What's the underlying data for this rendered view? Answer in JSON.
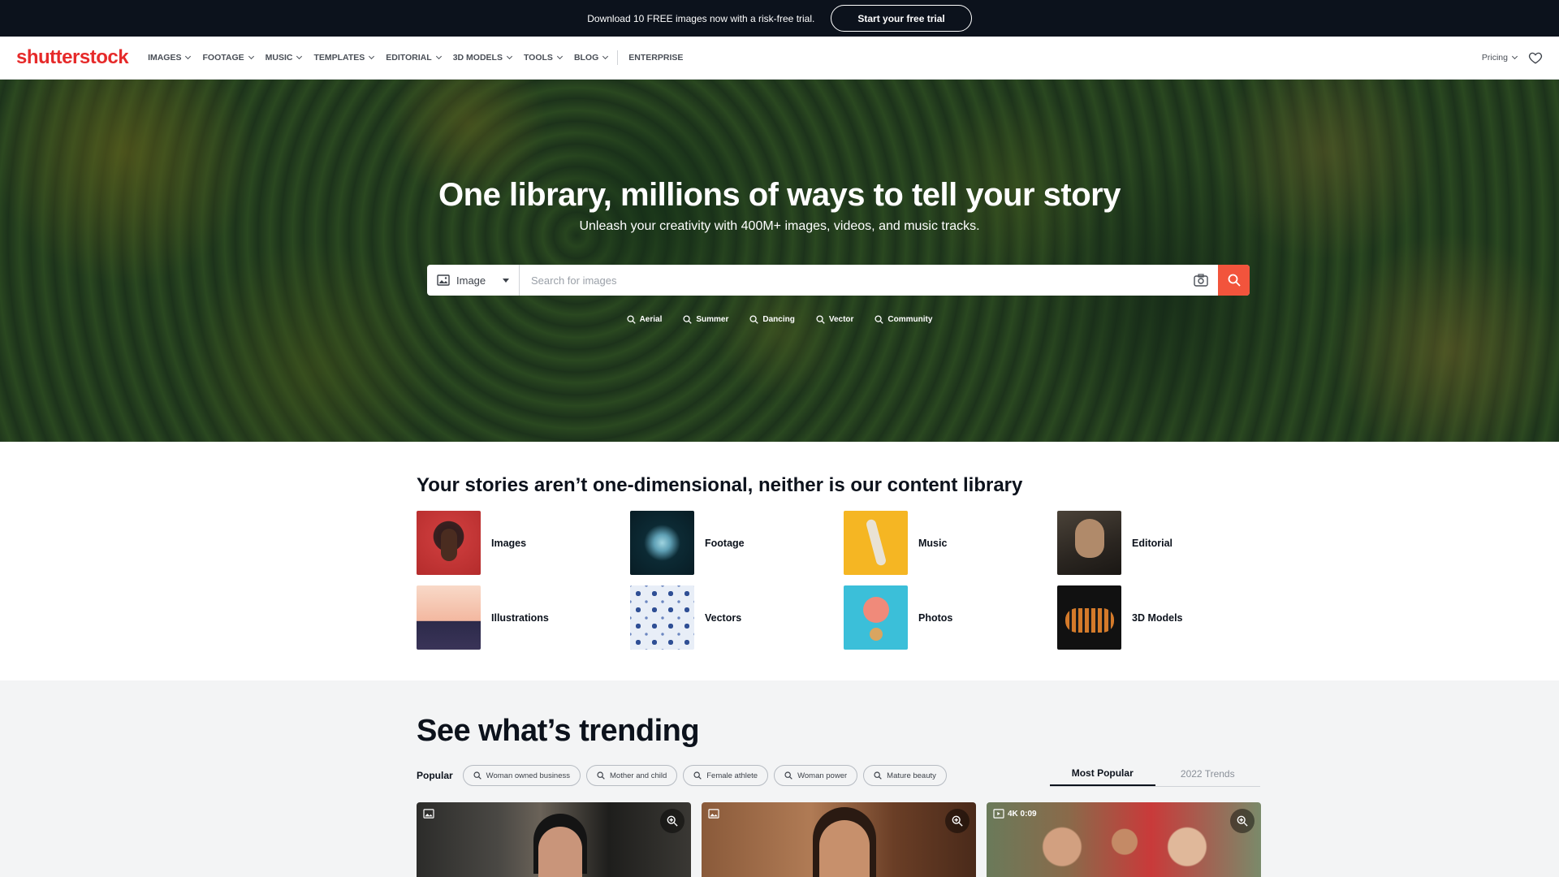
{
  "promo": {
    "text": "Download 10 FREE images now with a risk-free trial.",
    "cta": "Start your free trial"
  },
  "nav": {
    "logo_a": "shutterst",
    "logo_b": "ck",
    "items": [
      "IMAGES",
      "FOOTAGE",
      "MUSIC",
      "TEMPLATES",
      "EDITORIAL",
      "3D MODELS",
      "TOOLS",
      "BLOG"
    ],
    "enterprise": "ENTERPRISE",
    "pricing": "Pricing"
  },
  "hero": {
    "title": "One library, millions of ways to tell your story",
    "subtitle": "Unleash your creativity with 400M+ images, videos, and music tracks.",
    "search_type": "Image",
    "search_placeholder": "Search for images",
    "quick_searches": [
      "Aerial",
      "Summer",
      "Dancing",
      "Vector",
      "Community"
    ]
  },
  "library": {
    "title": "Your stories aren’t one-dimensional, neither is our content library",
    "items": [
      "Images",
      "Footage",
      "Music",
      "Editorial",
      "Illustrations",
      "Vectors",
      "Photos",
      "3D Models"
    ]
  },
  "trending": {
    "title": "See what’s trending",
    "popular_label": "Popular",
    "chips": [
      "Woman owned business",
      "Mother and child",
      "Female athlete",
      "Woman power",
      "Mature beauty"
    ],
    "tabs": [
      "Most Popular",
      "2022 Trends"
    ],
    "cards": [
      {
        "type": "image",
        "badge": ""
      },
      {
        "type": "image",
        "badge": ""
      },
      {
        "type": "video",
        "badge": "4K 0:09"
      }
    ]
  },
  "colors": {
    "brand_red": "#e62a2a",
    "search_button": "#f2543c",
    "dark_bar": "#0c121c"
  }
}
